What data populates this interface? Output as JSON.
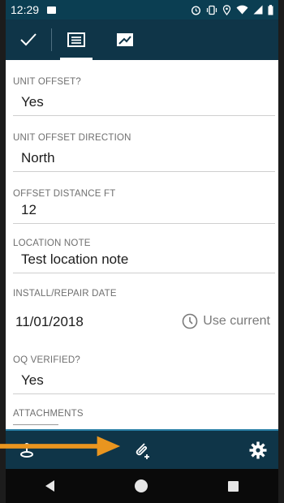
{
  "status_bar": {
    "time": "12:29",
    "icons": [
      "image-icon",
      "alarm-icon",
      "vibrate-icon",
      "location-icon",
      "wifi-icon",
      "signal-icon",
      "battery-icon"
    ]
  },
  "toolbar": {
    "buttons": [
      "check-icon",
      "form-tab-icon",
      "map-tab-icon"
    ]
  },
  "fields": [
    {
      "label": "UNIT OFFSET?",
      "value": "Yes"
    },
    {
      "label": "UNIT OFFSET DIRECTION",
      "value": "North"
    },
    {
      "label": "OFFSET DISTANCE FT",
      "value": "12"
    },
    {
      "label": "LOCATION NOTE",
      "value": "Test location note"
    },
    {
      "label": "INSTALL/REPAIR DATE",
      "value": "11/01/2018",
      "action": "Use current"
    },
    {
      "label": "OQ VERIFIED?",
      "value": "Yes"
    },
    {
      "label": "ATTACHMENTS"
    }
  ],
  "bottom_bar": {
    "buttons": [
      "location-pin-icon",
      "attachment-add-icon",
      "settings-gear-icon"
    ]
  },
  "colors": {
    "toolbar_bg": "#0f3548",
    "status_bg": "#0b3e52",
    "accent_arrow": "#e9951f",
    "label_text": "#6f6f6f"
  }
}
